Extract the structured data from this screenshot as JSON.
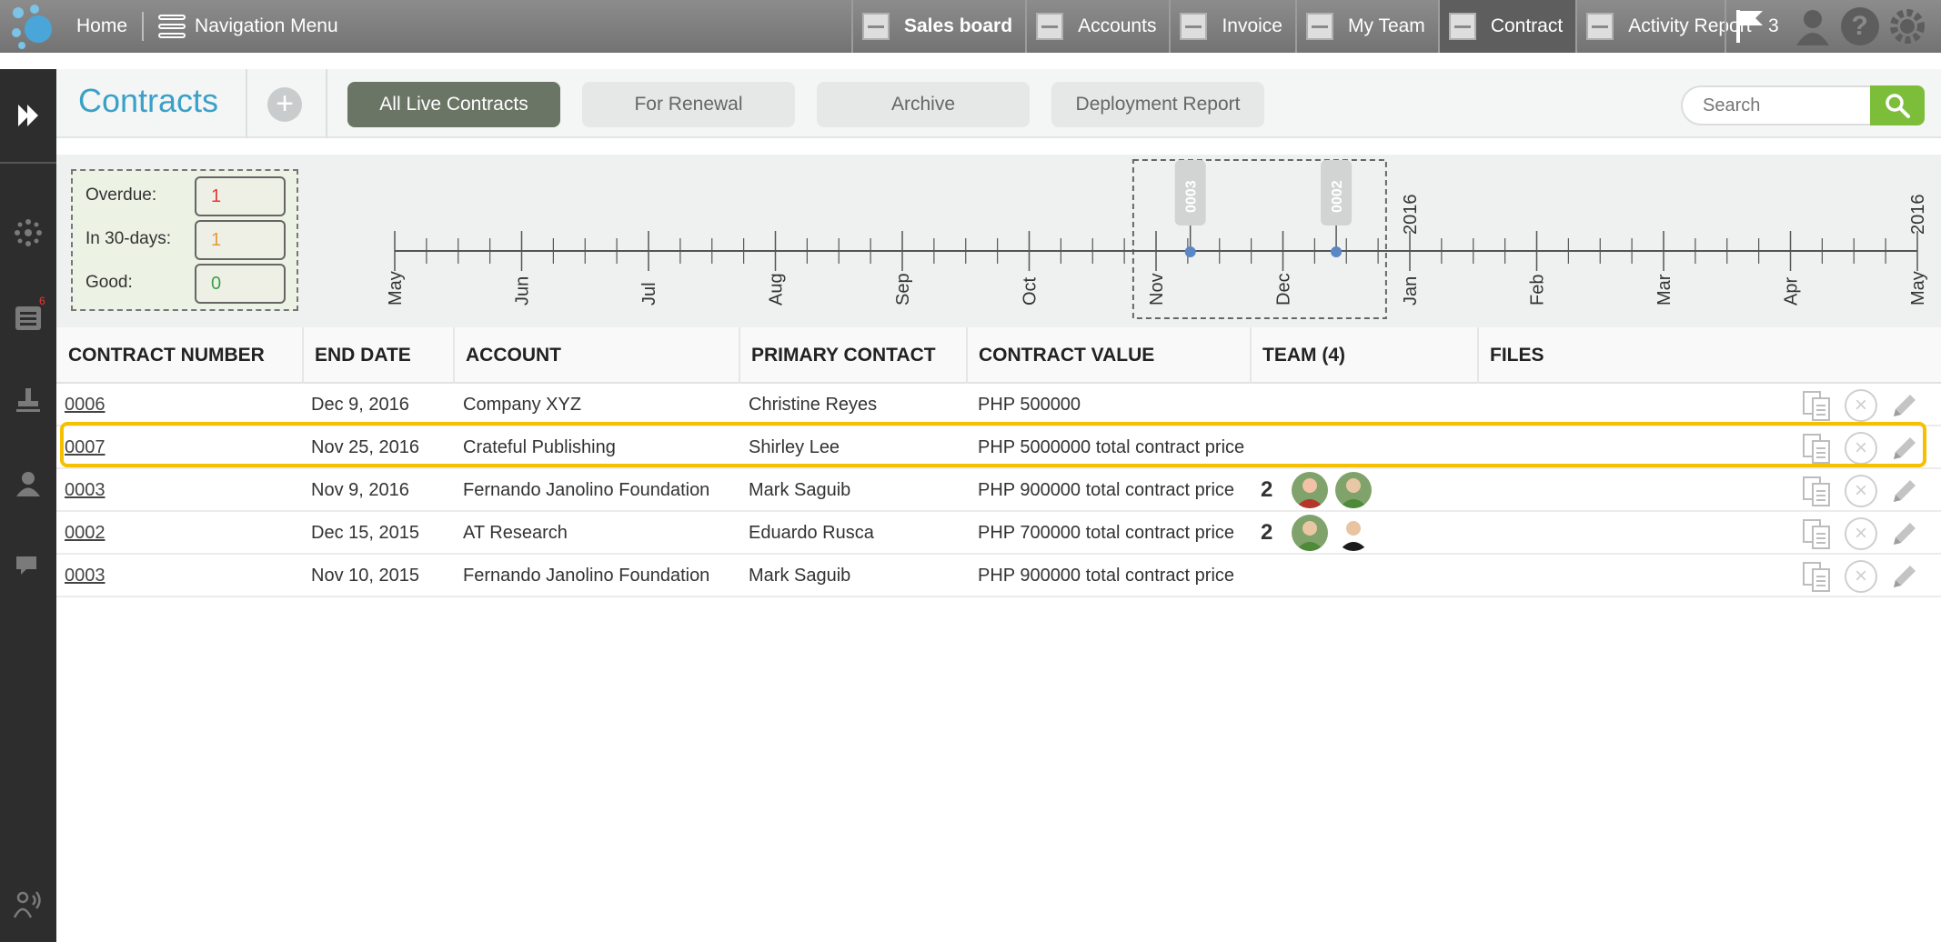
{
  "topbar": {
    "logo_icon": "app-logo-icon",
    "home": "Home",
    "navigation_menu": "Navigation Menu",
    "tabs": [
      {
        "label": "Sales board",
        "icon": "sales-board-icon",
        "bold": true
      },
      {
        "label": "Accounts",
        "icon": "accounts-icon"
      },
      {
        "label": "Invoice",
        "icon": "invoice-icon"
      },
      {
        "label": "My Team",
        "icon": "my-team-icon"
      },
      {
        "label": "Contract",
        "icon": "contract-icon",
        "active": true
      },
      {
        "label": "Activity Report",
        "icon": "activity-report-icon"
      }
    ],
    "flag_count": "3"
  },
  "sidebar": {
    "notification_badge": "6",
    "icons": [
      "expand-icon",
      "hub-icon",
      "list-icon",
      "stamp-icon",
      "user-icon",
      "chat-icon",
      "broadcast-icon"
    ]
  },
  "header": {
    "title": "Contracts",
    "add": "+",
    "filters": [
      "All Live Contracts",
      "For Renewal",
      "Archive",
      "Deployment Report"
    ],
    "active_filter": "All Live Contracts",
    "search_placeholder": "Search"
  },
  "summary": {
    "overdue_label": "Overdue:",
    "overdue_value": "1",
    "in30_label": "In 30-days:",
    "in30_value": "1",
    "good_label": "Good:",
    "good_value": "0"
  },
  "timeline": {
    "months": [
      "May",
      "Jun",
      "Jul",
      "Aug",
      "Sep",
      "Oct",
      "Nov",
      "Dec",
      "Jan",
      "Feb",
      "Mar",
      "Apr",
      "May"
    ],
    "year_labels": [
      "2016",
      "2016"
    ],
    "markers": [
      "0003",
      "0002"
    ]
  },
  "table": {
    "columns": [
      "CONTRACT NUMBER",
      "END DATE",
      "ACCOUNT",
      "PRIMARY CONTACT",
      "CONTRACT VALUE",
      "TEAM (4)",
      "FILES"
    ],
    "rows": [
      {
        "number": "0006",
        "end_date": "Dec 9, 2016",
        "account": "Company XYZ",
        "contact": "Christine Reyes",
        "value": "PHP 500000",
        "team": ""
      },
      {
        "number": "0007",
        "end_date": "Nov 25, 2016",
        "account": "Crateful Publishing",
        "contact": "Shirley Lee",
        "value": "PHP 5000000 total contract price",
        "team": "",
        "highlighted": true
      },
      {
        "number": "0003",
        "end_date": "Nov 9, 2016",
        "account": "Fernando Janolino Foundation",
        "contact": "Mark Saguib",
        "value": "PHP 900000 total contract price",
        "team": "2"
      },
      {
        "number": "0002",
        "end_date": "Dec 15, 2015",
        "account": "AT Research",
        "contact": "Eduardo Rusca",
        "value": "PHP 700000 total contract price",
        "team": "2"
      },
      {
        "number": "0003",
        "end_date": "Nov 10, 2015",
        "account": "Fernando Janolino Foundation",
        "contact": "Mark Saguib",
        "value": "PHP 900000 total contract price",
        "team": ""
      }
    ]
  },
  "colors": {
    "accent_title": "#3aa0c8",
    "overdue": "#e53935",
    "in30": "#e59a3a",
    "good": "#3aa04a",
    "highlight": "#f5c000",
    "search_button": "#7cbe3a"
  }
}
